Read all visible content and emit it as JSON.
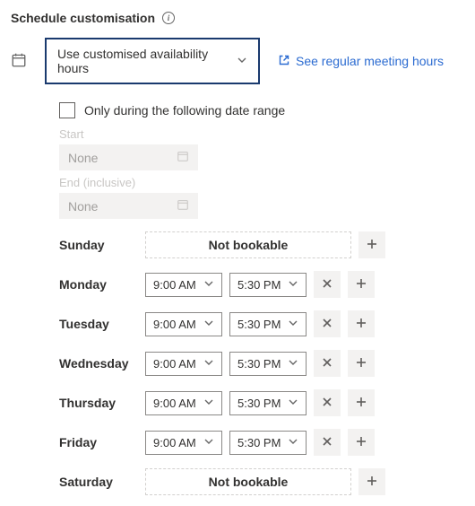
{
  "header": {
    "title": "Schedule customisation"
  },
  "mode": {
    "selected": "Use customised availability hours"
  },
  "link": {
    "label": "See regular meeting hours"
  },
  "dateRange": {
    "checkboxLabel": "Only during the following date range",
    "startLabel": "Start",
    "endLabel": "End (inclusive)",
    "startValue": "None",
    "endValue": "None"
  },
  "days": [
    {
      "name": "Sunday",
      "bookable": false,
      "notBookableLabel": "Not bookable"
    },
    {
      "name": "Monday",
      "bookable": true,
      "start": "9:00 AM",
      "end": "5:30 PM"
    },
    {
      "name": "Tuesday",
      "bookable": true,
      "start": "9:00 AM",
      "end": "5:30 PM"
    },
    {
      "name": "Wednesday",
      "bookable": true,
      "start": "9:00 AM",
      "end": "5:30 PM"
    },
    {
      "name": "Thursday",
      "bookable": true,
      "start": "9:00 AM",
      "end": "5:30 PM"
    },
    {
      "name": "Friday",
      "bookable": true,
      "start": "9:00 AM",
      "end": "5:30 PM"
    },
    {
      "name": "Saturday",
      "bookable": false,
      "notBookableLabel": "Not bookable"
    }
  ]
}
